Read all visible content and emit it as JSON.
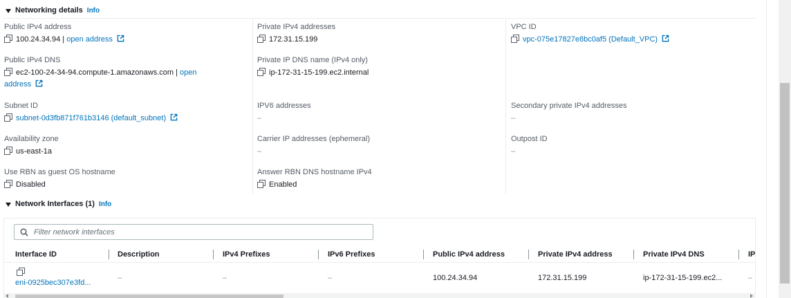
{
  "networking": {
    "title": "Networking details",
    "info": "Info",
    "fields": {
      "public_ipv4_address": {
        "label": "Public IPv4 address",
        "value": "100.24.34.94",
        "separator": " | ",
        "link": "open address"
      },
      "private_ipv4_addresses": {
        "label": "Private IPv4 addresses",
        "value": "172.31.15.199"
      },
      "vpc_id": {
        "label": "VPC ID",
        "value": "vpc-075e17827e8bc0af5 (Default_VPC)"
      },
      "public_ipv4_dns": {
        "label": "Public IPv4 DNS",
        "value": "ec2-100-24-34-94.compute-1.amazonaws.com",
        "separator": " | ",
        "link_part1": "open",
        "link_part2": "address"
      },
      "private_ip_dns_name": {
        "label": "Private IP DNS name (IPv4 only)",
        "value": "ip-172-31-15-199.ec2.internal"
      },
      "subnet_id": {
        "label": "Subnet ID",
        "value": "subnet-0d3fb871f761b3146 (default_subnet)"
      },
      "ipv6_addresses": {
        "label": "IPV6 addresses",
        "value": "–"
      },
      "secondary_private_ipv4": {
        "label": "Secondary private IPv4 addresses",
        "value": "–"
      },
      "availability_zone": {
        "label": "Availability zone",
        "value": "us-east-1a"
      },
      "carrier_ip": {
        "label": "Carrier IP addresses (ephemeral)",
        "value": "–"
      },
      "outpost_id": {
        "label": "Outpost ID",
        "value": "–"
      },
      "use_rbn": {
        "label": "Use RBN as guest OS hostname",
        "value": "Disabled"
      },
      "answer_rbn": {
        "label": "Answer RBN DNS hostname IPv4",
        "value": "Enabled"
      }
    }
  },
  "network_interfaces": {
    "title": "Network Interfaces (1)",
    "info": "Info",
    "search_placeholder": "Filter network interfaces",
    "columns": [
      "Interface ID",
      "Description",
      "IPv4 Prefixes",
      "IPv6 Prefixes",
      "Public IPv4 address",
      "Private IPv4 address",
      "Private IPv4 DNS",
      "IP"
    ],
    "rows": [
      {
        "interface_id": "eni-0925bec307e3fd...",
        "description": "–",
        "ipv4_prefixes": "–",
        "ipv6_prefixes": "–",
        "public_ipv4": "100.24.34.94",
        "private_ipv4": "172.31.15.199",
        "private_ipv4_dns": "ip-172-31-15-199.ec2...",
        "ip": "–"
      }
    ]
  },
  "colors": {
    "link": "#0073bb",
    "label": "#545b64",
    "text": "#16191f",
    "divider": "#eaeded"
  },
  "icons": [
    "caret-down-icon",
    "copy-icon",
    "external-link-icon",
    "search-icon"
  ]
}
